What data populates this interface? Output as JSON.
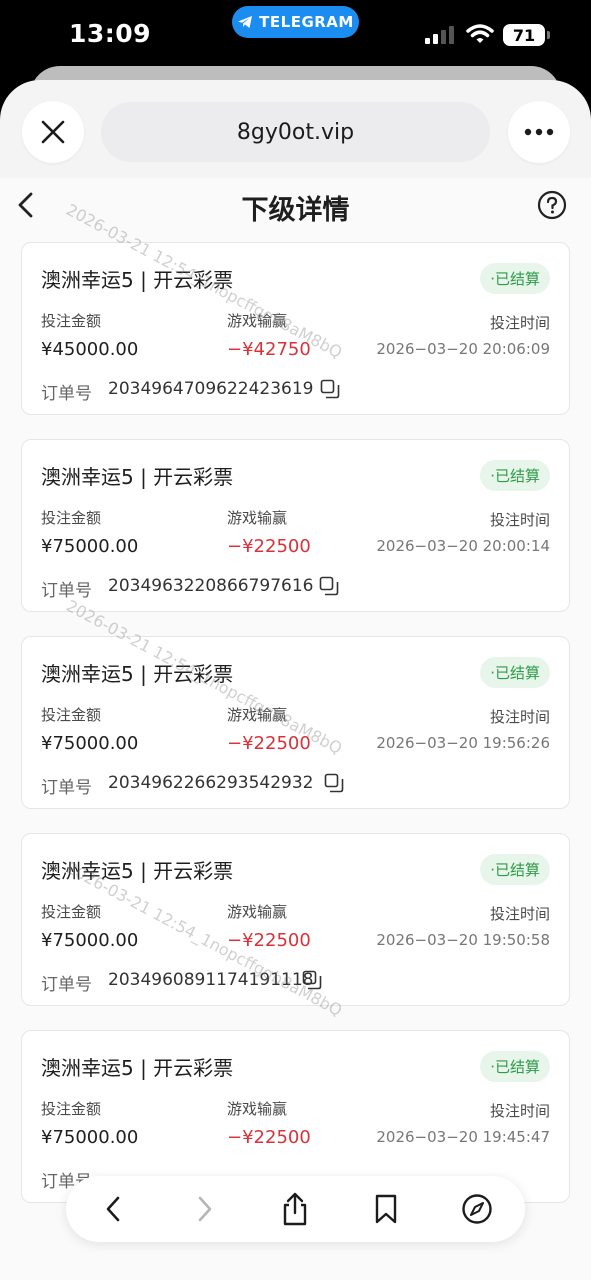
{
  "status_bar": {
    "time": "13:09",
    "telegram_label": "TELEGRAM",
    "battery": "71"
  },
  "browser": {
    "url": "8gy0ot.vip"
  },
  "page": {
    "title": "下级详情"
  },
  "labels": {
    "bet_amount": "投注金额",
    "game_result": "游戏输赢",
    "bet_time": "投注时间",
    "order_no": "订单号"
  },
  "orders": [
    {
      "title": "澳洲幸运5 | 开云彩票",
      "status": "·已结算",
      "amount": "¥45000.00",
      "result": "−¥42750",
      "time": "2026−03−20 20:06:09",
      "order_no": "2034964709622423619"
    },
    {
      "title": "澳洲幸运5 | 开云彩票",
      "status": "·已结算",
      "amount": "¥75000.00",
      "result": "−¥22500",
      "time": "2026−03−20 20:00:14",
      "order_no": "2034963220866797616"
    },
    {
      "title": "澳洲幸运5 | 开云彩票",
      "status": "·已结算",
      "amount": "¥75000.00",
      "result": "−¥22500",
      "time": "2026−03−20 19:56:26",
      "order_no": "2034962266293542932"
    },
    {
      "title": "澳洲幸运5 | 开云彩票",
      "status": "·已结算",
      "amount": "¥75000.00",
      "result": "−¥22500",
      "time": "2026−03−20 19:50:58",
      "order_no": "2034960891174191118"
    },
    {
      "title": "澳洲幸运5 | 开云彩票",
      "status": "·已结算",
      "amount": "¥75000.00",
      "result": "−¥22500",
      "time": "2026−03−20 19:45:47",
      "order_no": ""
    }
  ],
  "watermarks": [
    "2026-03-21 12:54_1nopcffggb8aM8bQ",
    "2026-03-21 12:54_1nopcffggb8aM8bQ",
    "2026-03-21 12:54_1nopcffggb8aM8bQ"
  ],
  "colors": {
    "accent_green": "#2f9c4a",
    "loss_red": "#d8323a",
    "telegram_blue": "#1b8cf0"
  },
  "icons": [
    "close-icon",
    "more-icon",
    "back-icon",
    "help-icon",
    "copy-icon",
    "forward-icon",
    "share-icon",
    "bookmarks-icon",
    "compass-icon"
  ]
}
